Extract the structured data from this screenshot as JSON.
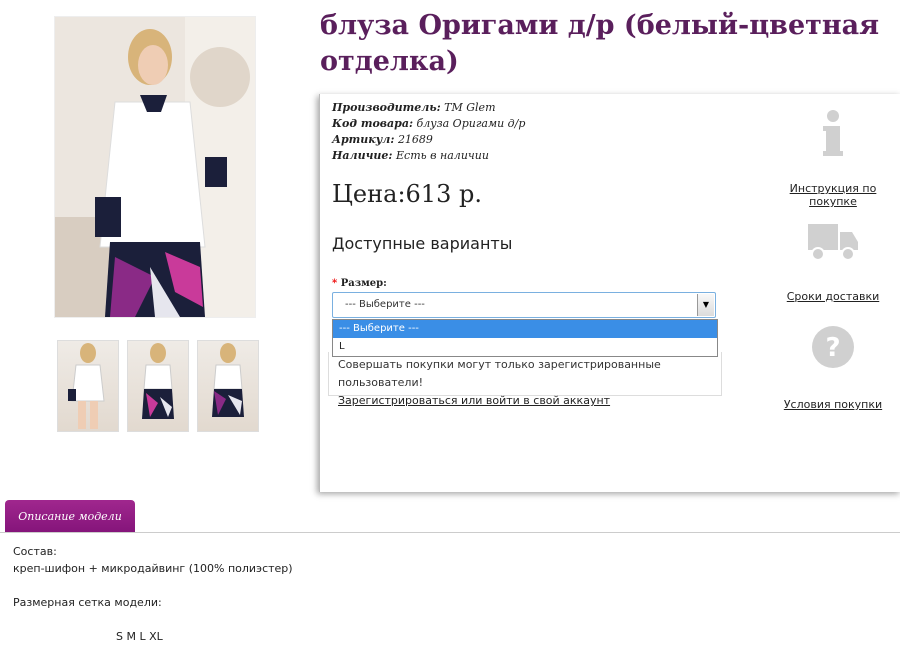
{
  "product": {
    "title": "блуза Оригами д/р (белый-цветная отделка)",
    "meta": [
      {
        "label": "Производитель:",
        "value": "TM Glem"
      },
      {
        "label": "Код товара:",
        "value": "блуза Оригами д/р"
      },
      {
        "label": "Артикул:",
        "value": "21689"
      },
      {
        "label": "Наличие:",
        "value": "Есть в наличии"
      }
    ],
    "price": "Цена:613 р.",
    "variants_heading": "Доступные варианты",
    "size_label": "Размер:",
    "size_required_mark": "*",
    "size_selected": "--- Выберите ---",
    "size_options": [
      "--- Выберите ---",
      "L"
    ],
    "notice_text": "Совершать покупки могут только зарегистрированные пользователи!",
    "notice_link": "Зарегистрироваться или войти в свой аккаунт"
  },
  "side_links": [
    {
      "icon": "info-icon",
      "label": "Инструкция по покупке"
    },
    {
      "icon": "truck-icon",
      "label": "Сроки доставки"
    },
    {
      "icon": "question-icon",
      "label": "Условия покупки"
    }
  ],
  "tabs": [
    {
      "label": "Описание модели"
    }
  ],
  "description": {
    "composition_label": "Состав:",
    "composition_value": "креп-шифон + микродайвинг (100% полиэстер)",
    "size_grid_label": "Размерная сетка модели:",
    "size_grid": "S M L XL"
  },
  "colors": {
    "title": "#5a1f5c",
    "tab": "#8e1a82",
    "select_highlight": "#3a8ee6"
  }
}
